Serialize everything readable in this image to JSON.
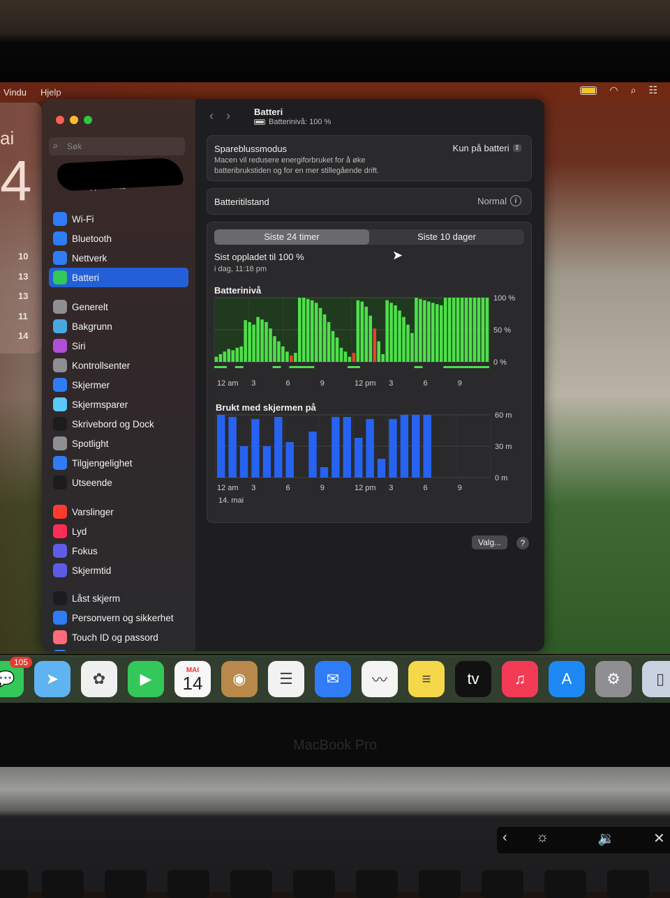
{
  "menubar": {
    "items": [
      "Vindu",
      "Hjelp"
    ]
  },
  "widget": {
    "day_fragment": "ai",
    "big_fragment": "4",
    "numbers": [
      "10",
      "13",
      "13",
      "11",
      "14"
    ]
  },
  "search": {
    "placeholder": "Søk"
  },
  "account": {
    "label": "Apple-konto"
  },
  "sidebar": {
    "items": [
      {
        "label": "Wi-Fi",
        "icon": "wifi-icon",
        "color": "#2f7cf6"
      },
      {
        "label": "Bluetooth",
        "icon": "bluetooth-icon",
        "color": "#2f7cf6"
      },
      {
        "label": "Nettverk",
        "icon": "globe-icon",
        "color": "#2f7cf6"
      },
      {
        "label": "Batteri",
        "icon": "battery-icon",
        "color": "#34c759",
        "active": true
      },
      {
        "label": "Generelt",
        "icon": "gear-icon",
        "color": "#8e8e93"
      },
      {
        "label": "Bakgrunn",
        "icon": "wallpaper-icon",
        "color": "#4aa8e0"
      },
      {
        "label": "Siri",
        "icon": "siri-icon",
        "color": "#b04fd6"
      },
      {
        "label": "Kontrollsenter",
        "icon": "control-center-icon",
        "color": "#8e8e93"
      },
      {
        "label": "Skjermer",
        "icon": "sun-icon",
        "color": "#2f7cf6"
      },
      {
        "label": "Skjermsparer",
        "icon": "screensaver-icon",
        "color": "#5ac8fa"
      },
      {
        "label": "Skrivebord og Dock",
        "icon": "dock-icon",
        "color": "#1c1c1e"
      },
      {
        "label": "Spotlight",
        "icon": "magnifier-icon",
        "color": "#8e8e93"
      },
      {
        "label": "Tilgjengelighet",
        "icon": "accessibility-icon",
        "color": "#2f7cf6"
      },
      {
        "label": "Utseende",
        "icon": "appearance-icon",
        "color": "#1c1c1e"
      },
      {
        "label": "Varslinger",
        "icon": "bell-icon",
        "color": "#ff3b30"
      },
      {
        "label": "Lyd",
        "icon": "speaker-icon",
        "color": "#ff2d55"
      },
      {
        "label": "Fokus",
        "icon": "moon-icon",
        "color": "#5e5ce6"
      },
      {
        "label": "Skjermtid",
        "icon": "hourglass-icon",
        "color": "#5e5ce6"
      },
      {
        "label": "Låst skjerm",
        "icon": "lock-icon",
        "color": "#1c1c1e"
      },
      {
        "label": "Personvern og sikkerhet",
        "icon": "hand-icon",
        "color": "#2f7cf6"
      },
      {
        "label": "Touch ID og passord",
        "icon": "fingerprint-icon",
        "color": "#ff6b7a"
      },
      {
        "label": "Brukere og grupper",
        "icon": "users-icon",
        "color": "#2f7cf6"
      }
    ]
  },
  "header": {
    "title": "Batteri",
    "subtitle": "Batterinivå: 100 %"
  },
  "power_mode": {
    "label": "Spareblussmodus",
    "value": "Kun på batteri",
    "description": "Macen vil redusere energiforbruket for å øke batteribrukstiden og for en mer stillegående drift."
  },
  "health": {
    "label": "Batteritilstand",
    "value": "Normal"
  },
  "tabs": [
    {
      "label": "Siste 24 timer",
      "selected": true
    },
    {
      "label": "Siste 10 dager",
      "selected": false
    }
  ],
  "last_charged": {
    "title": "Sist oppladet til 100 %",
    "time": "i dag, 11:18 pm"
  },
  "chart_data": [
    {
      "type": "bar",
      "title": "Batterinivå",
      "ylim": [
        0,
        100
      ],
      "y_ticks": [
        "100 %",
        "50 %",
        "0 %"
      ],
      "x_ticks": [
        "12 am",
        "3",
        "6",
        "9",
        "12 pm",
        "3",
        "6",
        "9"
      ],
      "values": [
        8,
        12,
        16,
        20,
        18,
        22,
        24,
        65,
        62,
        58,
        70,
        66,
        62,
        52,
        40,
        32,
        24,
        16,
        10,
        14,
        100,
        100,
        98,
        96,
        92,
        84,
        74,
        62,
        48,
        38,
        22,
        16,
        8,
        14,
        96,
        94,
        86,
        72,
        52,
        32,
        12,
        96,
        92,
        88,
        80,
        70,
        58,
        45,
        100,
        98,
        96,
        94,
        92,
        90,
        88,
        100,
        100,
        100,
        100,
        100,
        100,
        100,
        100,
        100,
        100,
        100
      ],
      "charging": [
        1,
        1,
        1,
        0,
        0,
        1,
        1,
        0,
        0,
        0,
        0,
        0,
        0,
        0,
        1,
        1,
        0,
        0,
        1,
        1,
        1,
        1,
        1,
        1,
        0,
        0,
        0,
        0,
        0,
        0,
        0,
        0,
        1,
        1,
        1,
        0,
        0,
        0,
        0,
        0,
        0,
        0,
        0,
        0,
        0,
        0,
        0,
        0,
        1,
        1,
        0,
        0,
        0,
        0,
        0,
        1,
        1,
        1,
        1,
        1,
        1,
        1,
        1,
        1,
        1,
        1
      ],
      "red_marks": [
        18,
        33,
        38
      ]
    },
    {
      "type": "bar",
      "title": "Brukt med skjermen på",
      "ylim": [
        0,
        60
      ],
      "y_ticks": [
        "60 m",
        "30 m",
        "0 m"
      ],
      "x_ticks": [
        "12 am",
        "3",
        "6",
        "9",
        "12 pm",
        "3",
        "6",
        "9"
      ],
      "date_label": "14. mai",
      "values": [
        60,
        58,
        30,
        56,
        30,
        58,
        34,
        0,
        44,
        10,
        58,
        58,
        38,
        56,
        18,
        56,
        60,
        60,
        60,
        0,
        0,
        0,
        0,
        0
      ]
    }
  ],
  "buttons": {
    "options": "Valg...",
    "help": "?"
  },
  "dock": {
    "badge": "105",
    "calendar_month": "MAI",
    "calendar_day": "14",
    "apps": [
      {
        "name": "messages-icon",
        "color": "#34c759",
        "glyph": "💬"
      },
      {
        "name": "maps-icon",
        "color": "#5fb3f0",
        "glyph": "➤"
      },
      {
        "name": "photos-icon",
        "color": "#f0f0f0",
        "glyph": "✿"
      },
      {
        "name": "facetime-icon",
        "color": "#34c759",
        "glyph": "▶"
      },
      {
        "name": "calendar-icon",
        "color": "#f7f7f7",
        "glyph": ""
      },
      {
        "name": "contacts-icon",
        "color": "#b8894a",
        "glyph": "◉"
      },
      {
        "name": "reminders-icon",
        "color": "#f2f2f2",
        "glyph": "☰"
      },
      {
        "name": "mail-icon",
        "color": "#2f7cf6",
        "glyph": "✉"
      },
      {
        "name": "freeform-icon",
        "color": "#f4f4f4",
        "glyph": "〰"
      },
      {
        "name": "notes-icon",
        "color": "#f5d74a",
        "glyph": "≡"
      },
      {
        "name": "appletv-icon",
        "color": "#111111",
        "glyph": "tv"
      },
      {
        "name": "music-icon",
        "color": "#f33b55",
        "glyph": "♫"
      },
      {
        "name": "appstore-icon",
        "color": "#1e88f5",
        "glyph": "A"
      },
      {
        "name": "system-settings-icon",
        "color": "#8e8e93",
        "glyph": "⚙"
      },
      {
        "name": "iphone-mirroring-icon",
        "color": "#c9d2e0",
        "glyph": "▯"
      }
    ]
  },
  "laptop": {
    "brand": "MacBook Pro"
  }
}
